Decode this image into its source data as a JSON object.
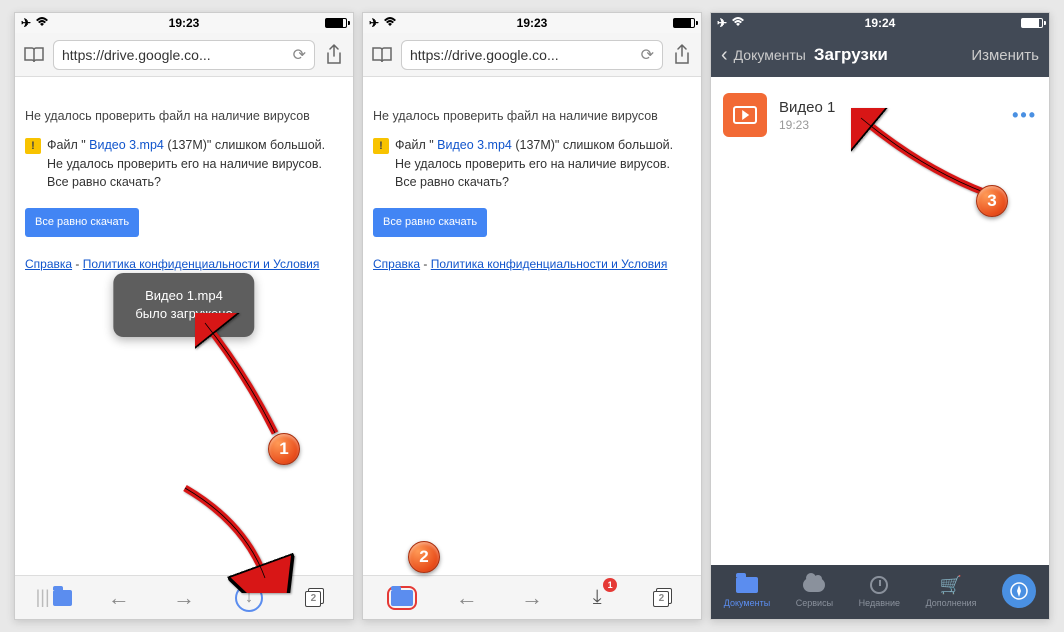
{
  "phone1": {
    "time": "19:23",
    "url": "https://drive.google.co...",
    "heading": "Не удалось проверить файл на наличие вирусов",
    "body_prefix": "Файл \" ",
    "file_link": "Видео 3.mp4",
    "body_suffix": " (137M)\" слишком большой. Не удалось проверить его на наличие вирусов. Все равно скачать?",
    "button": "Все равно скачать",
    "link_help": "Справка",
    "link_sep": " - ",
    "link_policy": "Политика конфиденциальности и Условия",
    "toast_l1": "Видео 1.mp4",
    "toast_l2": "было загружено",
    "tabs_count": "2"
  },
  "phone2": {
    "time": "19:23",
    "url": "https://drive.google.co...",
    "heading": "Не удалось проверить файл на наличие вирусов",
    "body_prefix": "Файл \" ",
    "file_link": "Видео 3.mp4",
    "body_suffix": " (137M)\" слишком большой. Не удалось проверить его на наличие вирусов. Все равно скачать?",
    "button": "Все равно скачать",
    "link_help": "Справка",
    "link_sep": " - ",
    "link_policy": "Политика конфиденциальности и Условия",
    "tabs_count": "2",
    "badge": "1"
  },
  "phone3": {
    "time": "19:24",
    "back": "Документы",
    "title": "Загрузки",
    "edit": "Изменить",
    "file_name": "Видео 1",
    "file_time": "19:23",
    "tab_docs": "Документы",
    "tab_serv": "Сервисы",
    "tab_recent": "Недавние",
    "tab_addons": "Дополнения"
  },
  "annotations": {
    "n1": "1",
    "n2": "2",
    "n3": "3"
  }
}
